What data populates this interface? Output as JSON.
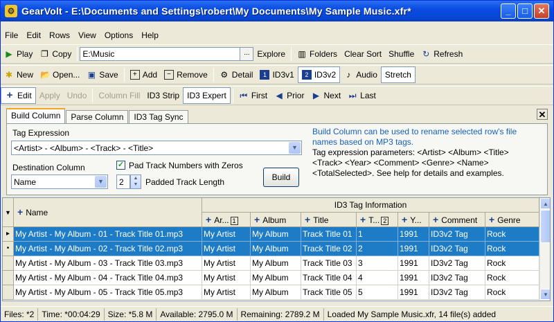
{
  "window": {
    "title": "GearVolt - E:\\Documents and Settings\\robert\\My Documents\\My Sample Music.xfr*",
    "app_icon": "gearvolt-icon"
  },
  "menu": [
    "File",
    "Edit",
    "Rows",
    "View",
    "Options",
    "Help"
  ],
  "toolbar1": {
    "play": "Play",
    "copy": "Copy",
    "path": "E:\\Music",
    "ellipsis": "...",
    "explore": "Explore",
    "folders": "Folders",
    "clear_sort": "Clear Sort",
    "shuffle": "Shuffle",
    "refresh": "Refresh"
  },
  "toolbar2": {
    "new": "New",
    "open": "Open...",
    "save": "Save",
    "add": "Add",
    "remove": "Remove",
    "detail": "Detail",
    "id3v1": "ID3v1",
    "id3v2": "ID3v2",
    "audio": "Audio",
    "stretch": "Stretch"
  },
  "toolbar3": {
    "edit": "Edit",
    "apply": "Apply",
    "undo": "Undo",
    "column_fill": "Column Fill",
    "id3_strip": "ID3 Strip",
    "id3_expert": "ID3 Expert",
    "first": "First",
    "prior": "Prior",
    "next": "Next",
    "last": "Last"
  },
  "tabs": [
    "Build Column",
    "Parse Column",
    "ID3 Tag Sync"
  ],
  "build": {
    "tag_expression_label": "Tag Expression",
    "tag_expression": "<Artist> - <Album> - <Track> - <Title>",
    "destination_label": "Destination Column",
    "destination": "Name",
    "pad_label": "Pad Track Numbers with Zeros",
    "pad_checked": true,
    "padded_length": "2",
    "padded_length_label": "Padded Track Length",
    "build_button": "Build",
    "info_line1": "Build Column can be used to rename selected row's file",
    "info_line2": "names based on MP3 tags.",
    "info_line3": "Tag expression parameters: <Artist> <Album> <Title>",
    "info_line4": "<Track> <Year> <Comment> <Genre> <Name>",
    "info_line5": "<TotalSelected>.  See help for details and examples."
  },
  "grid": {
    "group_header": "ID3 Tag Information",
    "columns": [
      "Name",
      "Ar...",
      "Album",
      "Title",
      "T...",
      "Y...",
      "Comment",
      "Genre"
    ],
    "sort_badges": {
      "artist": "1",
      "track": "2"
    },
    "rows": [
      {
        "indicator": "▸",
        "selected": true,
        "cells": [
          "My Artist - My Album - 01 - Track Title 01.mp3",
          "My Artist",
          "My Album",
          "Track Title 01",
          "1",
          "1991",
          "ID3v2 Tag",
          "Rock"
        ]
      },
      {
        "indicator": "•",
        "selected": true,
        "cells": [
          "My Artist - My Album - 02 - Track Title 02.mp3",
          "My Artist",
          "My Album",
          "Track Title 02",
          "2",
          "1991",
          "ID3v2 Tag",
          "Rock"
        ]
      },
      {
        "indicator": "",
        "selected": false,
        "cells": [
          "My Artist - My Album - 03 - Track Title 03.mp3",
          "My Artist",
          "My Album",
          "Track Title 03",
          "3",
          "1991",
          "ID3v2 Tag",
          "Rock"
        ]
      },
      {
        "indicator": "",
        "selected": false,
        "cells": [
          "My Artist - My Album - 04 - Track Title 04.mp3",
          "My Artist",
          "My Album",
          "Track Title 04",
          "4",
          "1991",
          "ID3v2 Tag",
          "Rock"
        ]
      },
      {
        "indicator": "",
        "selected": false,
        "cells": [
          "My Artist - My Album - 05 - Track Title 05.mp3",
          "My Artist",
          "My Album",
          "Track Title 05",
          "5",
          "1991",
          "ID3v2 Tag",
          "Rock"
        ]
      }
    ]
  },
  "status": {
    "files": "Files: *2",
    "time": "Time: *00:04:29",
    "size": "Size: *5.8 M",
    "available": "Available: 2795.0 M",
    "remaining": "Remaining: 2789.2 M",
    "message": "Loaded My Sample Music.xfr, 14 file(s) added"
  }
}
